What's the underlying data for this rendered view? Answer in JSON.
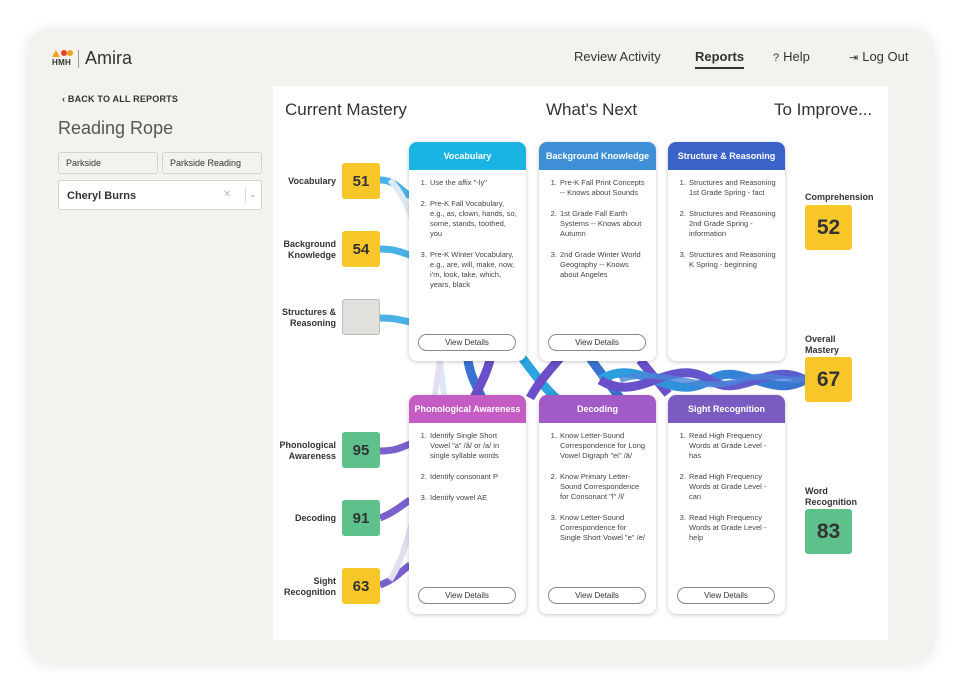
{
  "header": {
    "logo_mark": "HMH",
    "app_name": "Amira",
    "nav": [
      "Review Activity",
      "Reports",
      "Help",
      "Log Out"
    ],
    "active_nav": "Reports"
  },
  "sidebar": {
    "back_link": "BACK TO ALL REPORTS",
    "page_title": "Reading Rope",
    "school": "Parkside",
    "class": "Parkside Reading",
    "student": "Cheryl Burns"
  },
  "columns": {
    "current": "Current Mastery",
    "next": "What's Next",
    "improve": "To Improve..."
  },
  "strands": [
    {
      "label": "Vocabulary",
      "score": "51",
      "color": "#f7c629"
    },
    {
      "label": "Background Knowledge",
      "score": "54",
      "color": "#f7c629"
    },
    {
      "label": "Structures & Reasoning",
      "score": "",
      "color": "#e2e0dc"
    },
    {
      "label": "Phonological Awareness",
      "score": "95",
      "color": "#5ec08a"
    },
    {
      "label": "Decoding",
      "score": "91",
      "color": "#5ec08a"
    },
    {
      "label": "Sight Recognition",
      "score": "63",
      "color": "#f7c629"
    }
  ],
  "cards_top": [
    {
      "title": "Vocabulary",
      "color": "#1ab4e4",
      "items": [
        "Use the affix \"-ly\"",
        "Pre-K Fall Vocabulary, e.g., as, clown, hands, so, some, stands, toothed, you",
        "Pre-K Winter Vocabulary, e.g., are, will, make, now, i'm, look, take, which, years, black"
      ],
      "button": "View Details"
    },
    {
      "title": "Background Knowledge",
      "color": "#3f8fd6",
      "items": [
        "Pre-K Fall Print Concepts -- Knows about Sounds",
        "1st Grade Fall Earth Systems -- Knows about Autumn",
        "2nd Grade Winter World Geography -- Knows about Angeles"
      ],
      "button": "View Details"
    },
    {
      "title": "Structure & Reasoning",
      "color": "#3a62c8",
      "items": [
        "Structures and Reasoning 1st Grade Spring - fact",
        "Structures and Reasoning 2nd Grade Spring - information",
        "Structures and Reasoning K Spring - beginning"
      ],
      "button": ""
    }
  ],
  "cards_bottom": [
    {
      "title": "Phonological Awareness",
      "color": "#c45cc4",
      "items": [
        "Identify Single Short Vowel \"a\" /ă/ or /a/ in single syllable words",
        "Identify consonant P",
        "Identify vowel AE"
      ],
      "button": "View Details"
    },
    {
      "title": "Decoding",
      "color": "#a25ac6",
      "items": [
        "Know Letter-Sound Correspondence for Long Vowel Digraph \"ei\" /ā/",
        "Know Primary Letter-Sound Correspondence for Consonant \"l\" /l/",
        "Know Letter-Sound Correspondence for Single Short Vowel \"e\" /e/"
      ],
      "button": "View Details"
    },
    {
      "title": "Sight Recognition",
      "color": "#7a5bbf",
      "items": [
        "Read High Frequency Words at Grade Level - has",
        "Read High Frequency Words at Grade Level - can",
        "Read High Frequency Words at Grade Level - help"
      ],
      "button": "View Details"
    }
  ],
  "outcomes": [
    {
      "label": "Comprehension",
      "score": "52",
      "color": "#f7c629"
    },
    {
      "label": "Overall Mastery",
      "score": "67",
      "color": "#f7c629"
    },
    {
      "label": "Word Recognition",
      "score": "83",
      "color": "#5ec08a"
    }
  ]
}
